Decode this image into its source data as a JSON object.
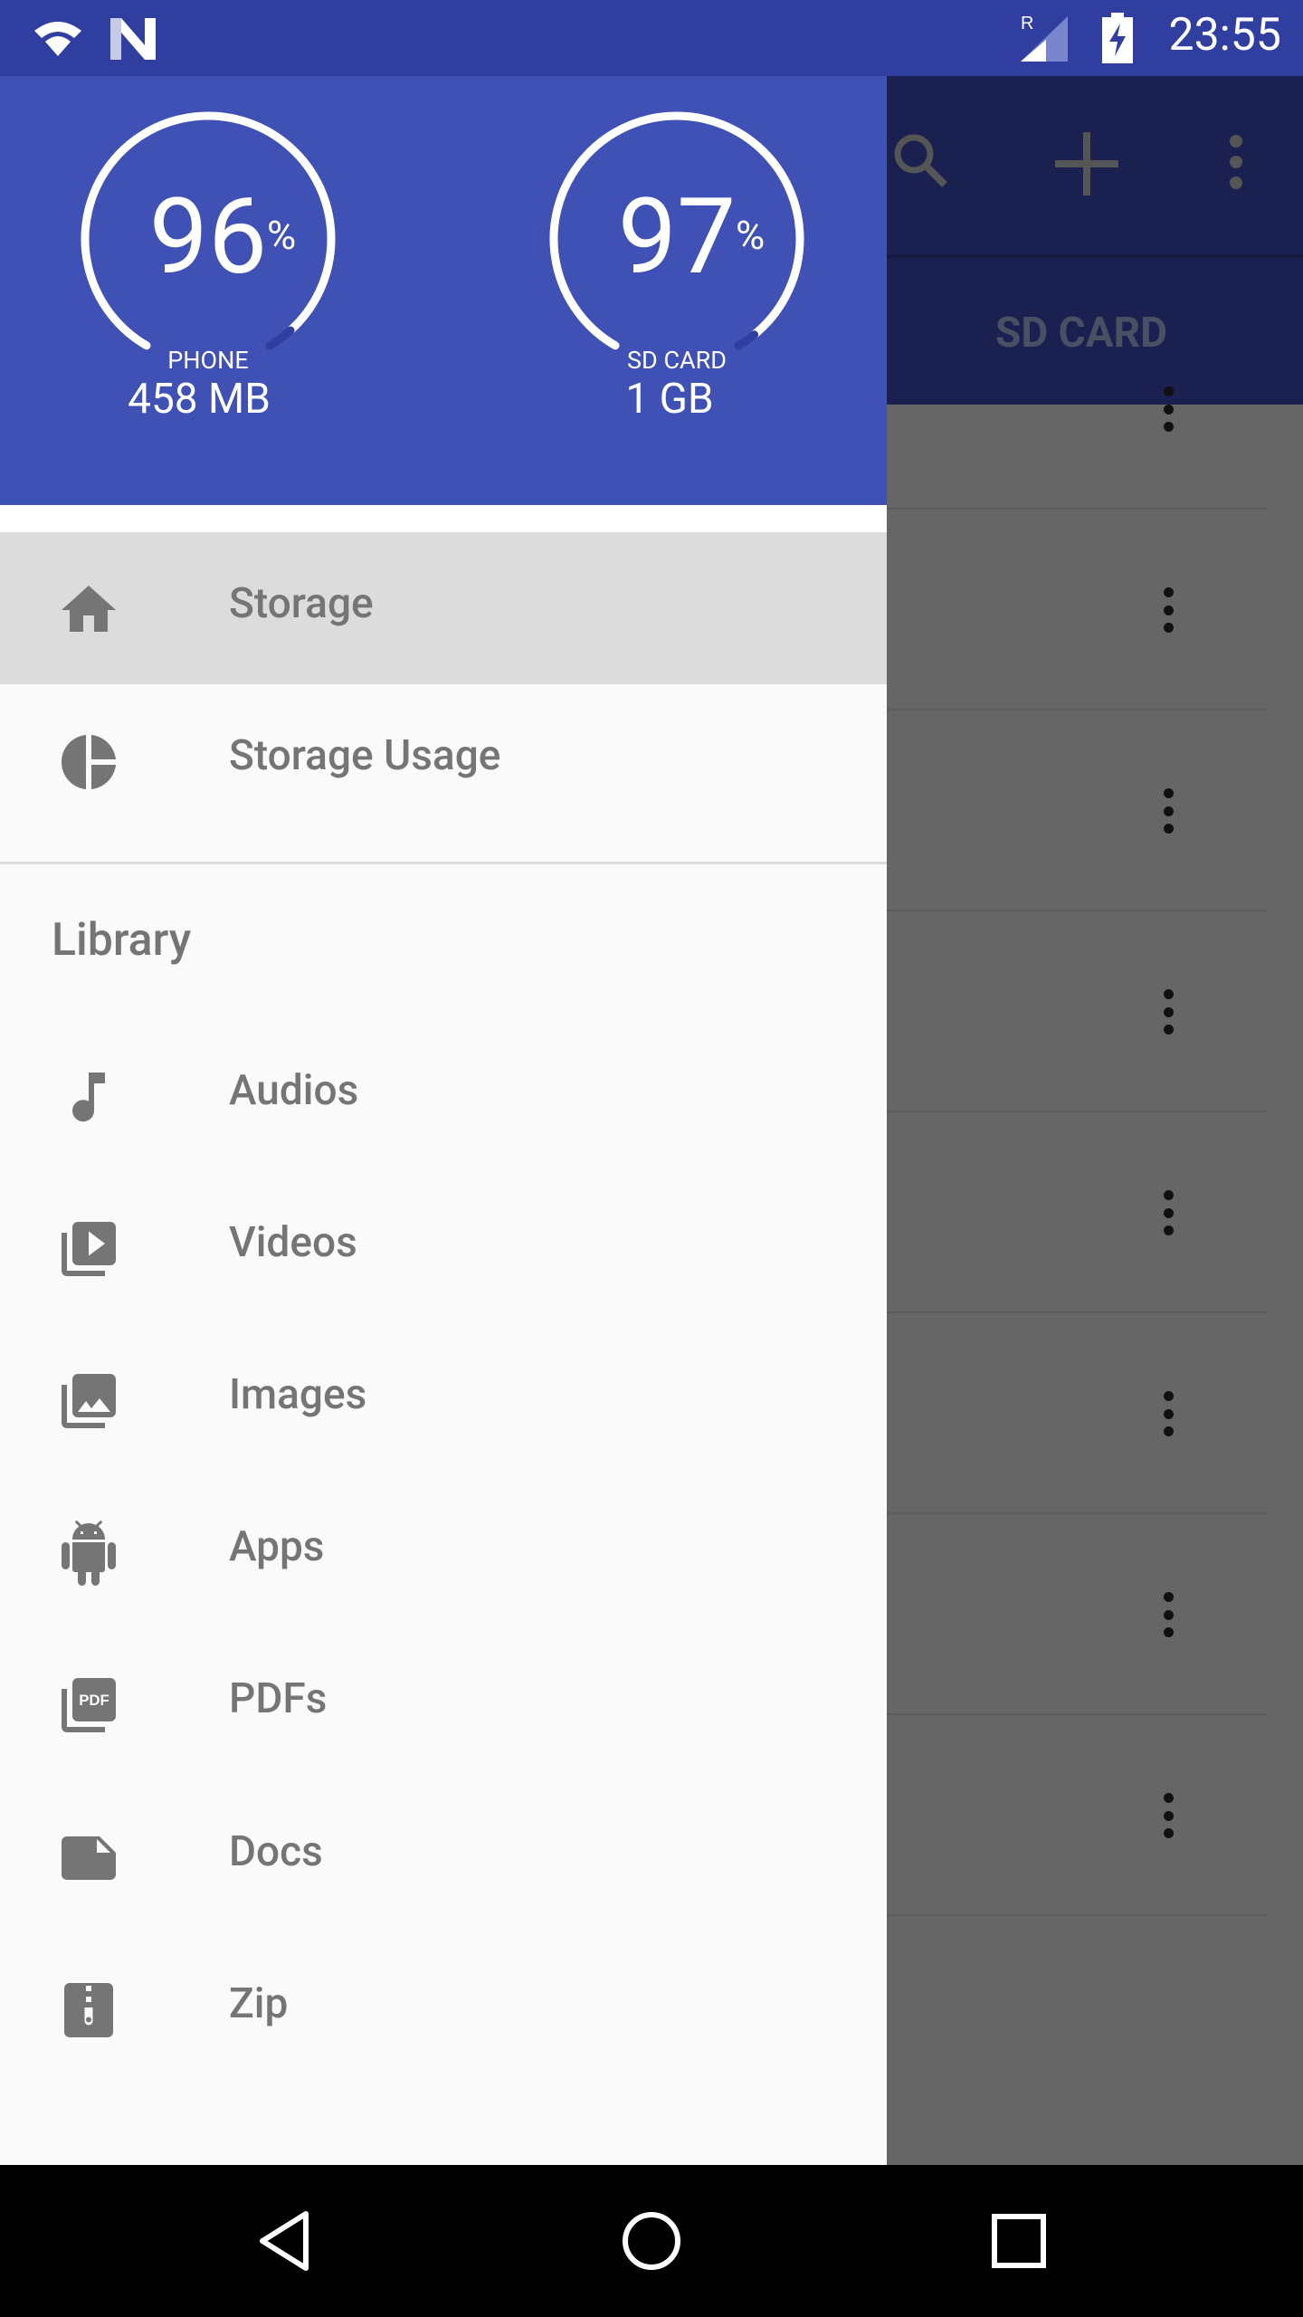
{
  "status_bar": {
    "time": "23:55",
    "icons": [
      "wifi-icon",
      "n-notification-icon",
      "signal-roaming-icon",
      "battery-charging-icon"
    ],
    "roaming_label": "R"
  },
  "background": {
    "toolbar_icons": [
      "search-icon",
      "add-icon",
      "more-vert-icon"
    ],
    "tab_label": "SD CARD",
    "row_count": 8
  },
  "drawer": {
    "header": {
      "color": "#3f51b5",
      "gauges": [
        {
          "percent": "96",
          "percent_sign": "%",
          "label": "PHONE",
          "size": "458 MB",
          "fill": 0.96
        },
        {
          "percent": "97",
          "percent_sign": "%",
          "label": "SD CARD",
          "size": "1 GB",
          "fill": 0.97
        }
      ]
    },
    "items": [
      {
        "label": "Storage",
        "icon": "home-icon",
        "selected": true
      },
      {
        "label": "Storage Usage",
        "icon": "pie-chart-icon"
      }
    ],
    "library_title": "Library",
    "library": [
      {
        "label": "Audios",
        "icon": "music-note-icon"
      },
      {
        "label": "Videos",
        "icon": "video-library-icon"
      },
      {
        "label": "Images",
        "icon": "photo-library-icon"
      },
      {
        "label": "Apps",
        "icon": "android-icon"
      },
      {
        "label": "PDFs",
        "icon": "pdf-icon",
        "icon_text": "PDF"
      },
      {
        "label": "Docs",
        "icon": "doc-icon"
      },
      {
        "label": "Zip",
        "icon": "zip-icon"
      }
    ]
  },
  "nav_bar": [
    "back-icon",
    "home-icon",
    "recents-icon"
  ]
}
